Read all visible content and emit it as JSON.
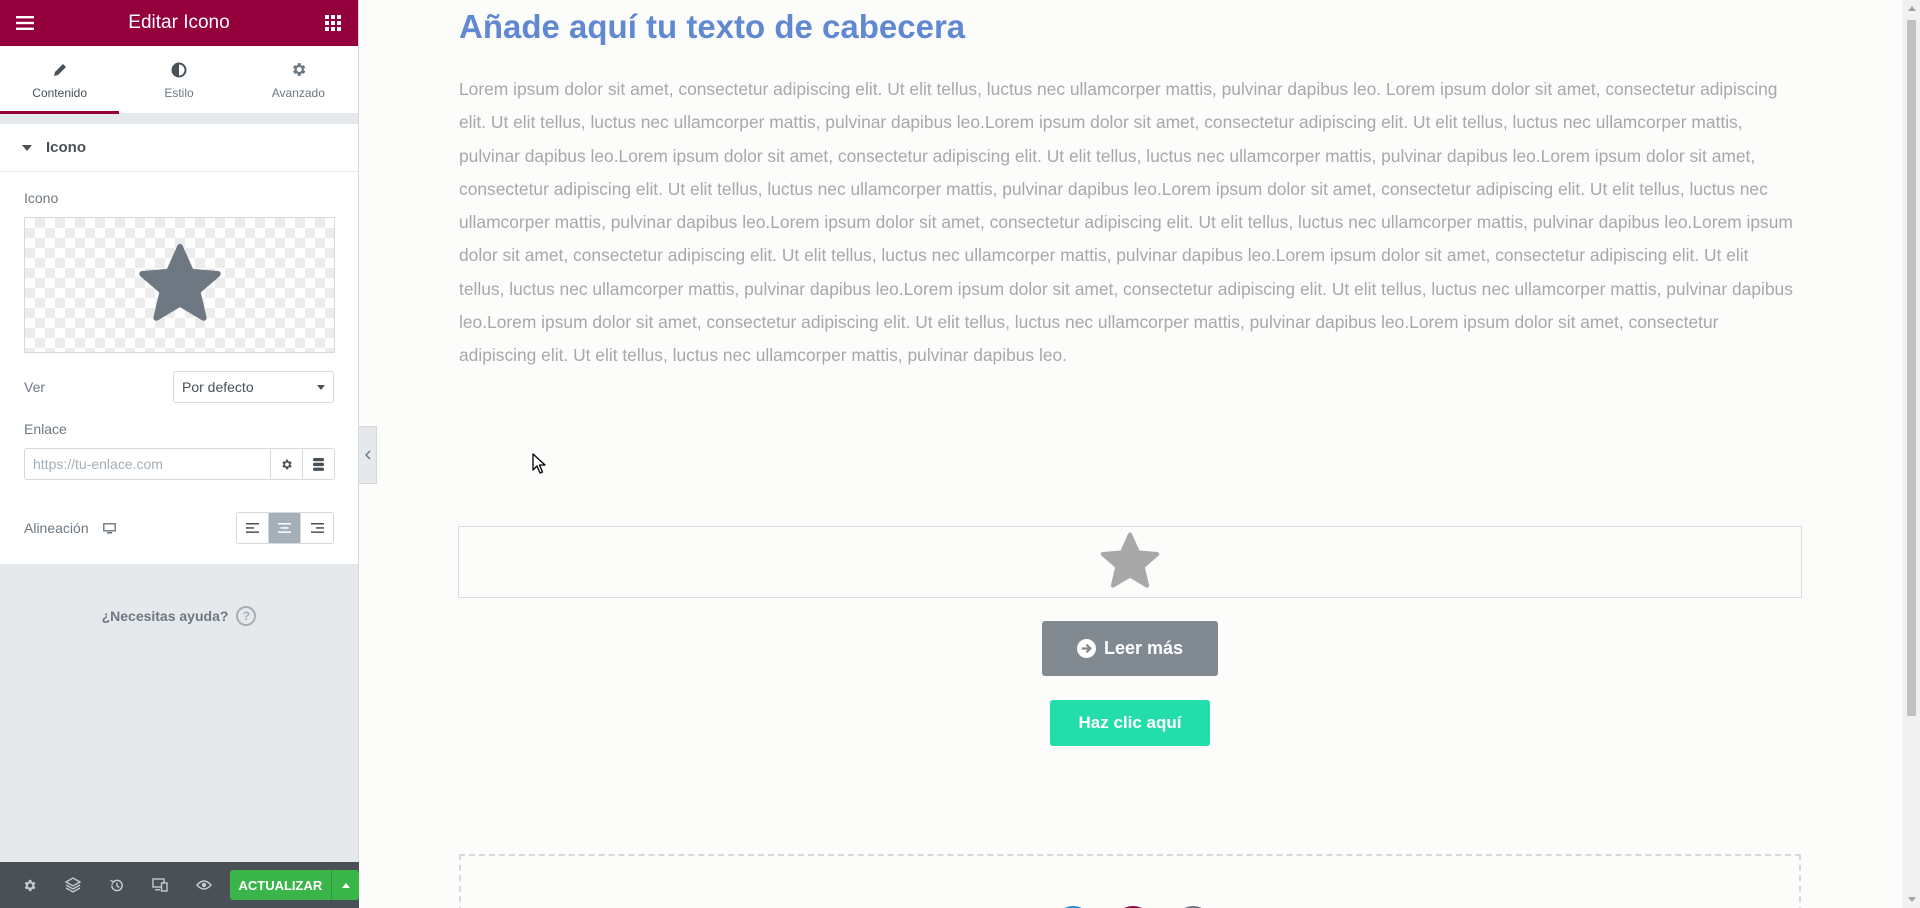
{
  "panel": {
    "title": "Editar Icono",
    "tabs": [
      {
        "label": "Contenido",
        "icon": "pencil-icon"
      },
      {
        "label": "Estilo",
        "icon": "half-circle-icon"
      },
      {
        "label": "Avanzado",
        "icon": "gear-icon"
      }
    ],
    "active_tab": "Contenido",
    "section_title": "Icono",
    "icon_label": "Icono",
    "icon_value": "star-icon",
    "view_label": "Ver",
    "view_value": "Por defecto",
    "link_label": "Enlace",
    "link_placeholder": "https://tu-enlace.com",
    "link_value": "",
    "align_label": "Alineación",
    "align_value": "center",
    "help_text": "¿Necesitas ayuda?",
    "help_icon_text": "?",
    "update_label": "ACTUALIZAR",
    "accent_color": "#93003c",
    "update_color": "#39b54a"
  },
  "preview": {
    "heading": "Añade aquí tu texto de cabecera",
    "paragraph": "Lorem ipsum dolor sit amet, consectetur adipiscing elit. Ut elit tellus, luctus nec ullamcorper mattis, pulvinar dapibus leo. Lorem ipsum dolor sit amet, consectetur adipiscing elit. Ut elit tellus, luctus nec ullamcorper mattis, pulvinar dapibus leo.Lorem ipsum dolor sit amet, consectetur adipiscing elit. Ut elit tellus, luctus nec ullamcorper mattis, pulvinar dapibus leo.Lorem ipsum dolor sit amet, consectetur adipiscing elit. Ut elit tellus, luctus nec ullamcorper mattis, pulvinar dapibus leo.Lorem ipsum dolor sit amet, consectetur adipiscing elit. Ut elit tellus, luctus nec ullamcorper mattis, pulvinar dapibus leo.Lorem ipsum dolor sit amet, consectetur adipiscing elit. Ut elit tellus, luctus nec ullamcorper mattis, pulvinar dapibus leo.Lorem ipsum dolor sit amet, consectetur adipiscing elit. Ut elit tellus, luctus nec ullamcorper mattis, pulvinar dapibus leo.Lorem ipsum dolor sit amet, consectetur adipiscing elit. Ut elit tellus, luctus nec ullamcorper mattis, pulvinar dapibus leo.Lorem ipsum dolor sit amet, consectetur adipiscing elit. Ut elit tellus, luctus nec ullamcorper mattis, pulvinar dapibus leo.Lorem ipsum dolor sit amet, consectetur adipiscing elit. Ut elit tellus, luctus nec ullamcorper mattis, pulvinar dapibus leo.Lorem ipsum dolor sit amet, consectetur adipiscing elit. Ut elit tellus, luctus nec ullamcorper mattis, pulvinar dapibus leo.Lorem ipsum dolor sit amet, consectetur adipiscing elit. Ut elit tellus, luctus nec ullamcorper mattis, pulvinar dapibus leo.",
    "read_more_label": "Leer más",
    "click_here_label": "Haz clic aquí",
    "heading_color": "#6089d2",
    "click_here_color": "#23ddab",
    "read_more_color": "#818a91"
  }
}
